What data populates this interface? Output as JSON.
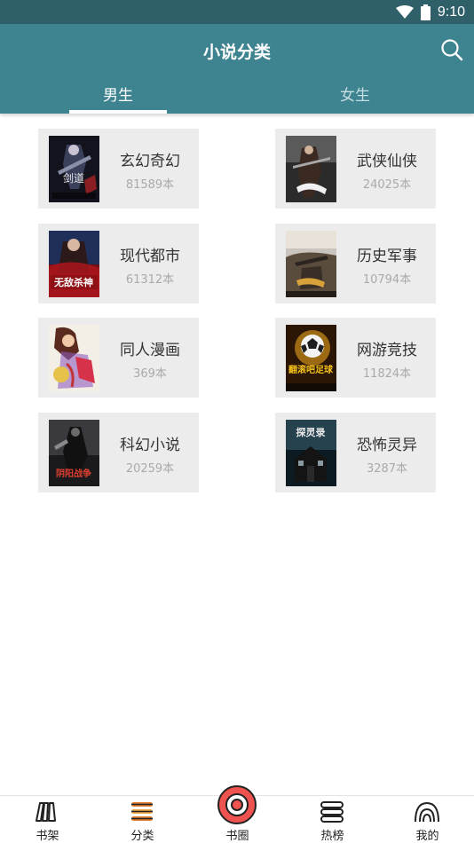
{
  "status": {
    "time": "9:10",
    "wifi_icon": "wifi-icon",
    "battery_icon": "battery-icon"
  },
  "header": {
    "title": "小说分类",
    "search_icon": "search-icon"
  },
  "tabs": [
    {
      "label": "男生",
      "active": true
    },
    {
      "label": "女生",
      "active": false
    }
  ],
  "categories": [
    {
      "name": "玄幻奇幻",
      "count": "81589本"
    },
    {
      "name": "武侠仙侠",
      "count": "24025本"
    },
    {
      "name": "现代都市",
      "count": "61312本"
    },
    {
      "name": "历史军事",
      "count": "10794本"
    },
    {
      "name": "同人漫画",
      "count": "369本"
    },
    {
      "name": "网游竞技",
      "count": "11824本"
    },
    {
      "name": "科幻小说",
      "count": "20259本"
    },
    {
      "name": "恐怖灵异",
      "count": "3287本"
    }
  ],
  "cover_text": [
    "剑道",
    "",
    "无敌杀神",
    "",
    "",
    "翻滚吧足球",
    "阴阳战争",
    "探灵录"
  ],
  "bottom_nav": [
    {
      "label": "书架",
      "icon": "bookshelf-icon"
    },
    {
      "label": "分类",
      "icon": "category-icon"
    },
    {
      "label": "书圈",
      "icon": "donut-icon"
    },
    {
      "label": "热榜",
      "icon": "ranking-icon"
    },
    {
      "label": "我的",
      "icon": "profile-icon"
    }
  ],
  "colors": {
    "statusbar": "#2f5f69",
    "appbar": "#3e8390",
    "accent_orange": "#e07a2e",
    "circle_red": "#ef5350"
  }
}
